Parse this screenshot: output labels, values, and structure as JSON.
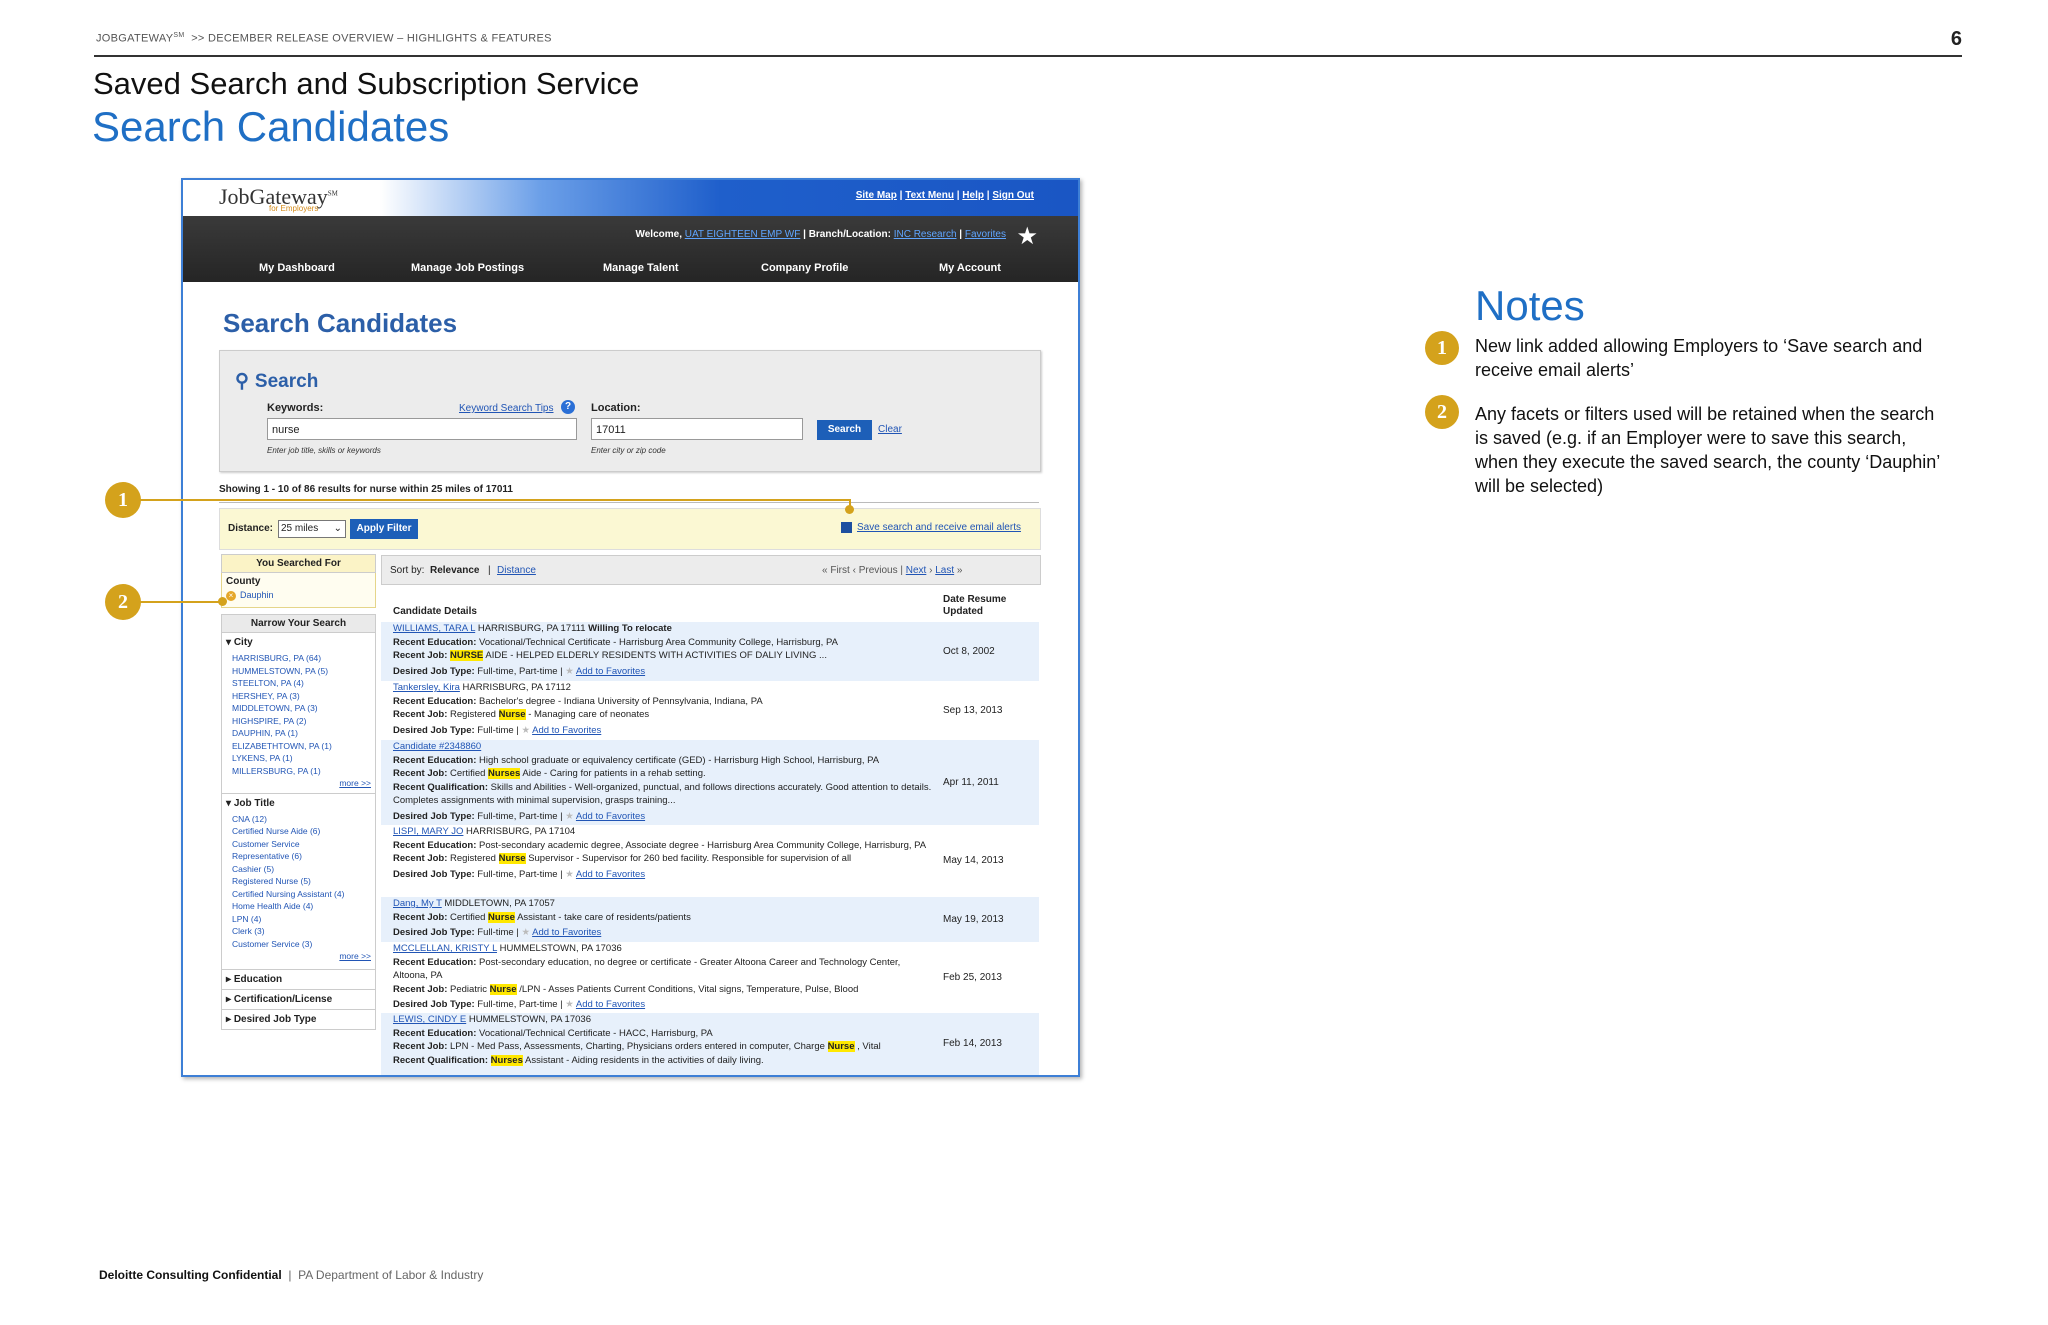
{
  "header": {
    "brand": "JOBGATEWAY",
    "brand_sup": "SM",
    "crumb": ">>  DECEMBER RELEASE OVERVIEW – HIGHLIGHTS & FEATURES",
    "page_number": "6"
  },
  "slide": {
    "subtitle": "Saved Search and Subscription Service",
    "title": "Search Candidates"
  },
  "notes": {
    "title": "Notes",
    "items": [
      {
        "num": "1",
        "text": "New link added allowing Employers to ‘Save search and receive email alerts’"
      },
      {
        "num": "2",
        "text": "Any facets or filters used will be retained when the search is saved (e.g. if an Employer were to save this search, when they execute the saved search, the county ‘Dauphin’ will be selected)"
      }
    ]
  },
  "callouts": {
    "one": "1",
    "two": "2"
  },
  "footer": {
    "confidential": "Deloitte Consulting Confidential",
    "sep": "|",
    "client": "PA Department of Labor & Industry"
  },
  "app": {
    "logo": "JobGateway",
    "logo_tm": "SM",
    "logo_sub": "for Employers",
    "toplinks": [
      "Site Map",
      "Text Menu",
      "Help",
      "Sign Out"
    ],
    "welcome_label": "Welcome,",
    "welcome_user": "UAT EIGHTEEN EMP WF",
    "branch_label": "Branch/Location:",
    "branch_value": "INC Research",
    "favorites": "Favorites",
    "nav": [
      "My Dashboard",
      "Manage Job Postings",
      "Manage Talent",
      "Company Profile",
      "My Account"
    ],
    "page_title": "Search Candidates",
    "search": {
      "title": "Search",
      "keywords_label": "Keywords:",
      "keyword_tips": "Keyword Search Tips",
      "keywords_value": "nurse",
      "keywords_hint": "Enter job title, skills or keywords",
      "location_label": "Location:",
      "location_value": "17011",
      "location_hint": "Enter city or zip code",
      "search_btn": "Search",
      "clear": "Clear"
    },
    "showing": "Showing 1 - 10 of 86 results for nurse within 25 miles of 17011",
    "filter": {
      "distance_label": "Distance:",
      "distance_value": "25 miles",
      "apply_btn": "Apply Filter",
      "save_link": "Save search and receive email alerts"
    },
    "sidebar": {
      "you_searched": "You Searched For",
      "county_label": "County",
      "county_value": "Dauphin",
      "narrow": "Narrow Your Search",
      "city_head": "City",
      "cities": [
        "HARRISBURG, PA (64)",
        "HUMMELSTOWN, PA (5)",
        "STEELTON, PA (4)",
        "HERSHEY, PA (3)",
        "MIDDLETOWN, PA (3)",
        "HIGHSPIRE, PA (2)",
        "DAUPHIN, PA (1)",
        "ELIZABETHTOWN, PA (1)",
        "LYKENS, PA (1)",
        "MILLERSBURG, PA (1)"
      ],
      "more1": "more >>",
      "job_head": "Job Title",
      "jobs": [
        "CNA (12)",
        "Certified Nurse Aide (6)",
        "Customer Service",
        "Representative (6)",
        "Cashier (5)",
        "Registered Nurse (5)",
        "Certified Nursing Assistant (4)",
        "Home Health Aide (4)",
        "LPN (4)",
        "Clerk (3)",
        "Customer Service (3)"
      ],
      "more2": "more >>",
      "education": "Education",
      "cert": "Certification/License",
      "desired": "Desired Job Type"
    },
    "sort": {
      "label": "Sort by:",
      "relevance": "Relevance",
      "sep": "|",
      "distance": "Distance",
      "first": "First",
      "previous": "Previous",
      "next": "Next",
      "last": "Last"
    },
    "cols": {
      "details": "Candidate Details",
      "date": "Date Resume Updated"
    },
    "candidates": [
      {
        "name": "WILLIAMS, TARA L",
        "loc": "HARRISBURG, PA 17111",
        "extra": "Willing To relocate",
        "lines": [
          [
            "Recent Education:",
            "Vocational/Technical Certificate - Harrisburg Area Community College, Harrisburg, PA"
          ],
          [
            "Recent Job:",
            "NURSE",
            "AIDE - HELPED ELDERLY RESIDENTS WITH ACTIVITIES OF DALIY LIVING ..."
          ]
        ],
        "desired": "Full-time, Part-time",
        "date": "Oct 8, 2002"
      },
      {
        "name": "Tankersley, Kira",
        "loc": "HARRISBURG, PA 17112",
        "extra": "",
        "lines": [
          [
            "Recent Education:",
            "Bachelor's degree - Indiana University of Pennsylvania, Indiana, PA"
          ],
          [
            "Recent Job:",
            "Registered",
            "Nurse",
            "- Managing care of neonates"
          ]
        ],
        "desired": "Full-time",
        "date": "Sep 13, 2013"
      },
      {
        "name": "Candidate #2348860",
        "loc": "",
        "extra": "",
        "lines": [
          [
            "Recent Education:",
            "High school graduate or equivalency certificate (GED) - Harrisburg High School, Harrisburg, PA"
          ],
          [
            "Recent Job:",
            "Certified",
            "Nurses",
            "Aide - Caring for patients in a rehab setting."
          ],
          [
            "Recent Qualification:",
            "Skills and Abilities - Well-organized, punctual, and follows directions accurately. Good attention to details. Completes assignments with minimal supervision, grasps training..."
          ]
        ],
        "desired": "Full-time, Part-time",
        "date": "Apr 11, 2011"
      },
      {
        "name": "LISPI, MARY JO",
        "loc": "HARRISBURG, PA 17104",
        "extra": "",
        "lines": [
          [
            "Recent Education:",
            "Post-secondary academic degree, Associate degree - Harrisburg Area Community College, Harrisburg, PA"
          ],
          [
            "Recent Job:",
            "Registered",
            "Nurse",
            "Supervisor - Supervisor for 260 bed facility. Responsible for supervision of all"
          ]
        ],
        "desired": "Full-time, Part-time",
        "date": "May 14, 2013"
      },
      {
        "name": "Dang, My T",
        "loc": "MIDDLETOWN, PA 17057",
        "extra": "",
        "lines": [
          [
            "Recent Job:",
            "Certified",
            "Nurse",
            "Assistant - take care of residents/patients"
          ]
        ],
        "desired": "Full-time",
        "date": "May 19, 2013"
      },
      {
        "name": "MCCLELLAN, KRISTY L",
        "loc": "HUMMELSTOWN, PA 17036",
        "extra": "",
        "lines": [
          [
            "Recent Education:",
            "Post-secondary education, no degree or certificate - Greater Altoona Career and Technology Center, Altoona, PA"
          ],
          [
            "Recent Job:",
            "Pediatric",
            "Nurse",
            "/LPN - Asses Patients Current Conditions, Vital signs, Temperature, Pulse, Blood"
          ]
        ],
        "desired": "Full-time, Part-time",
        "date": "Feb 25, 2013"
      },
      {
        "name": "LEWIS, CINDY E",
        "loc": "HUMMELSTOWN, PA 17036",
        "extra": "",
        "lines": [
          [
            "Recent Education:",
            "Vocational/Technical Certificate - HACC, Harrisburg, PA"
          ],
          [
            "Recent Job:",
            "LPN - Med Pass, Assessments, Charting, Physicians orders entered in computer, Charge",
            "Nurse",
            ", Vital"
          ],
          [
            "Recent Qualification:",
            "",
            "Nurses",
            "Assistant - Aiding residents in the activities of daily living."
          ]
        ],
        "desired": "",
        "date": "Feb 14, 2013"
      }
    ],
    "desired_label": "Desired Job Type:",
    "add_fav": "Add to Favorites"
  },
  "colors": {
    "accent": "#1f6fc5",
    "badge": "#d4a21c",
    "highlight": "#ffe800"
  }
}
